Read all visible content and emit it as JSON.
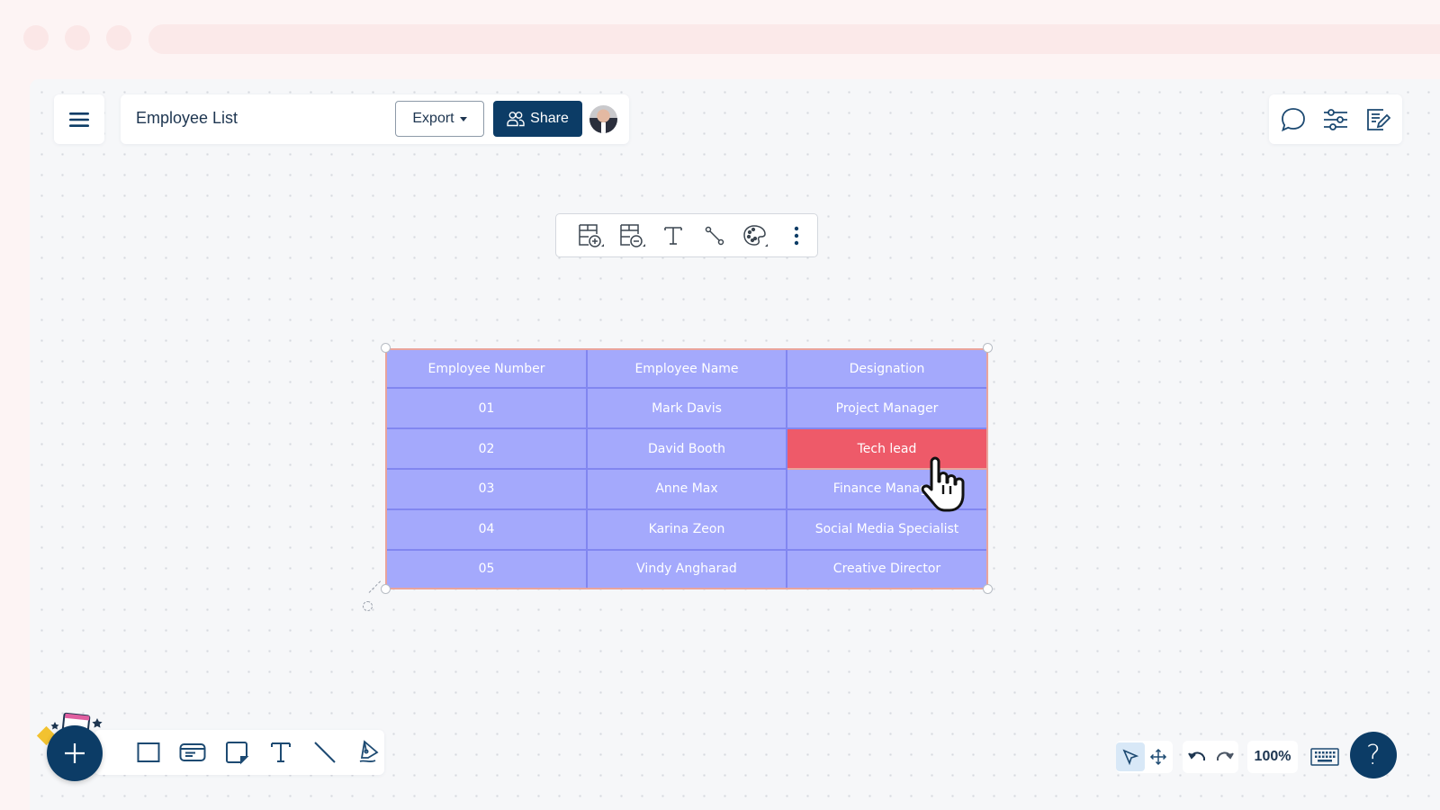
{
  "document": {
    "title": "Employee List"
  },
  "header": {
    "menu_icon": "hamburger-menu-icon",
    "export_label": "Export",
    "share_label": "Share",
    "share_icon": "users-icon",
    "avatar": "user-avatar"
  },
  "right_toolbar": {
    "items": [
      {
        "name": "comments",
        "icon": "chat-bubble-icon"
      },
      {
        "name": "settings",
        "icon": "sliders-icon"
      },
      {
        "name": "notes",
        "icon": "edit-note-icon"
      }
    ]
  },
  "table_toolbar": {
    "items": [
      {
        "name": "add-row-column",
        "icon": "table-add-icon"
      },
      {
        "name": "remove-row-column",
        "icon": "table-remove-icon"
      },
      {
        "name": "text",
        "icon": "text-icon"
      },
      {
        "name": "connector",
        "icon": "connector-icon"
      },
      {
        "name": "color-palette",
        "icon": "palette-icon"
      },
      {
        "name": "more-options",
        "icon": "more-vertical-icon"
      }
    ]
  },
  "table": {
    "headers": [
      "Employee Number",
      "Employee Name",
      "Designation"
    ],
    "rows": [
      [
        "01",
        "Mark Davis",
        "Project Manager"
      ],
      [
        "02",
        "David Booth",
        "Tech lead"
      ],
      [
        "03",
        "Anne Max",
        "Finance Manager"
      ],
      [
        "04",
        "Karina Zeon",
        "Social Media Specialist"
      ],
      [
        "05",
        "Vindy Angharad",
        "Creative Director"
      ]
    ],
    "selected_cell": {
      "row": 1,
      "col": 2
    },
    "colors": {
      "cell_fill": "#a4a9fc",
      "cell_border": "#8186f0",
      "highlight_fill": "#ee5a69",
      "selection_border": "#e9a49c"
    }
  },
  "shape_toolbar": {
    "add_icon": "plus-icon",
    "items": [
      {
        "name": "rectangle",
        "icon": "rectangle-icon"
      },
      {
        "name": "card",
        "icon": "card-icon"
      },
      {
        "name": "sticky-note",
        "icon": "sticky-note-icon"
      },
      {
        "name": "text",
        "icon": "text-icon"
      },
      {
        "name": "line",
        "icon": "line-icon"
      },
      {
        "name": "pen",
        "icon": "pen-icon"
      }
    ]
  },
  "bottom_controls": {
    "select_icon": "pointer-icon",
    "pan_icon": "move-icon",
    "undo_icon": "undo-icon",
    "redo_icon": "redo-icon",
    "zoom_level": "100%",
    "keyboard_icon": "keyboard-icon",
    "help_label": "?"
  },
  "colors": {
    "brand": "#0c3c66",
    "background": "#fdf4f4",
    "canvas": "#f6f7f9"
  }
}
